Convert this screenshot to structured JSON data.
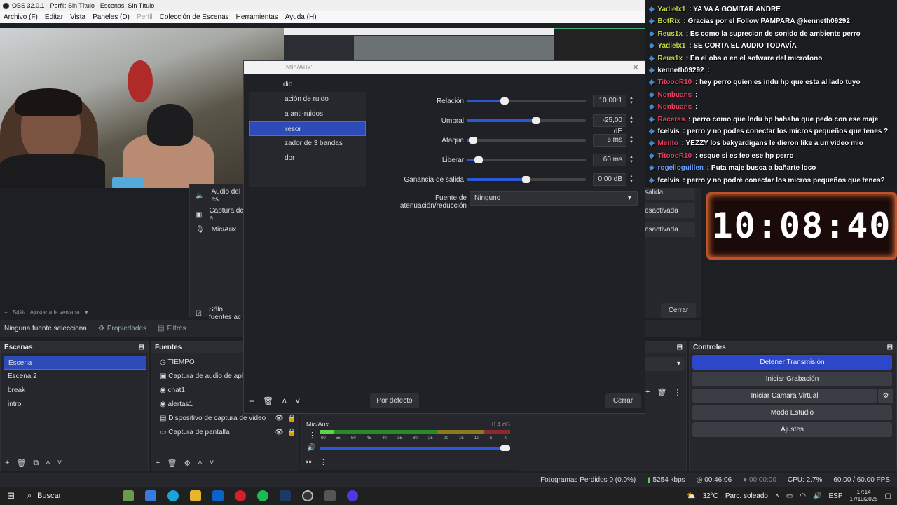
{
  "titlebar": {
    "title": "OBS 32.0.1 - Perfil: Sin Título - Escenas: Sin Título"
  },
  "menu": {
    "items": [
      "Archivo (F)",
      "Editar",
      "Vista",
      "Paneles (D)",
      "Perfil",
      "Colección de Escenas",
      "Herramientas",
      "Ayuda (H)"
    ]
  },
  "sources_panel_partial": {
    "items": [
      "Audio del es",
      "Captura de a",
      "Mic/Aux"
    ],
    "only_sources": "Sólo fuentes ac"
  },
  "zoom": {
    "level": "54%",
    "fit_label": "Ajustar a la ventana"
  },
  "propbar": {
    "no_source": "Ninguna fuente selecciona",
    "properties": "Propiedades",
    "filters": "Filtros"
  },
  "scenes": {
    "title": "Escenas",
    "items": [
      "Escena",
      "Escena 2",
      "break",
      "intro"
    ]
  },
  "sources": {
    "title": "Fuentes",
    "items": [
      "TIEMPO",
      "Captura de audio de aplicac",
      "chat1",
      "alertas1",
      "Dispositivo de captura de video",
      "Captura de pantalla"
    ]
  },
  "dialog": {
    "title": "'Mic/Aux'",
    "section": "dio",
    "filters": [
      "ación de ruido",
      "a anti-ruidos",
      "resor",
      "zador de 3 bandas",
      "dor"
    ],
    "params": [
      {
        "label": "Relación",
        "value": "10,00:1",
        "level": 0.32
      },
      {
        "label": "Umbral",
        "value": "-25,00 dE",
        "level": 0.58
      },
      {
        "label": "Ataque",
        "value": "6 ms",
        "level": 0.05
      },
      {
        "label": "Liberar",
        "value": "60 ms",
        "level": 0.1
      },
      {
        "label": "Ganancia de salida",
        "value": "0,00 dB",
        "level": 0.5
      }
    ],
    "duck_label": "Fuente de atenuación/reducción",
    "duck_value": "Ninguno",
    "default_button": "Por defecto",
    "close_button": "Cerrar"
  },
  "side_partial": {
    "items": [
      "salida",
      "esactivada",
      "esactivada"
    ],
    "close": "Cerrar"
  },
  "chat": {
    "lines": [
      {
        "user": "Yadielx1",
        "msg": ": YA VA A GOMITAR ANDRE",
        "color": "#c8d84a"
      },
      {
        "user": "BotRix",
        "msg": ": Gracias por el Follow PAMPARA @kenneth09292",
        "color": "#c8d84a"
      },
      {
        "user": "Reus1x",
        "msg": ": Es como la suprecion de sonido de ambiente perro",
        "color": "#c8d84a"
      },
      {
        "user": "Yadielx1",
        "msg": ": SE CORTA EL AUDIO TODAVÍA",
        "color": "#c8d84a"
      },
      {
        "user": "Reus1x",
        "msg": ": En el obs o en el sofware del microfono",
        "color": "#c8d84a"
      },
      {
        "user": "kenneth09292",
        "msg": ":",
        "color": "#fff"
      },
      {
        "user": "TitoooR10",
        "msg": ": hey perro quien es indu hp que esta al lado tuyo",
        "color": "#e74060"
      },
      {
        "user": "Nonbuans",
        "msg": ":",
        "color": "#e74060"
      },
      {
        "user": "Nonbuans",
        "msg": ":",
        "color": "#e74060"
      },
      {
        "user": "Raceras",
        "msg": ": perro como que Indu hp hahaha que pedo con ese maje",
        "color": "#e74060"
      },
      {
        "user": "fcelvis",
        "msg": ": perro y no podes conectar los micros pequeños que tenes ?",
        "color": "#fff"
      },
      {
        "user": "Mento",
        "msg": ": YEZZY los bakyardigans le dieron like a un video mio",
        "color": "#e74060"
      },
      {
        "user": "TitoooR10",
        "msg": ": esque si es feo ese hp perro",
        "color": "#e74060"
      },
      {
        "user": "rogelioguillen",
        "msg": ": Puta maje busca a bañarte loco",
        "color": "#6aa0ff"
      },
      {
        "user": "fcelvis",
        "msg": ": perro y no podré conectar los micros pequeños que tenes?",
        "color": "#fff"
      }
    ]
  },
  "timer": {
    "value": "10:08:40"
  },
  "mixer": {
    "name": "Mic/Aux",
    "level": "0.4 dB",
    "ticks": [
      "-60",
      "-55",
      "-50",
      "-45",
      "-40",
      "-35",
      "-30",
      "-25",
      "-20",
      "-15",
      "-10",
      "-5",
      "0"
    ]
  },
  "controls": {
    "title": "Controles",
    "buttons": [
      "Detener Transmisión",
      "Iniciar Grabación",
      "Iniciar Cámara Virtual",
      "Modo Estudio",
      "Ajustes"
    ]
  },
  "status": {
    "dropped": "Fotogramas Perdidos 0 (0.0%)",
    "bitrate": "5254 kbps",
    "stream_time": "00:46:06",
    "rec_time": "00:00:00",
    "cpu": "CPU: 2.7%",
    "fps": "60.00 / 60.00 FPS"
  },
  "taskbar": {
    "search": "Buscar",
    "weather": "32°C",
    "weather_desc": "Parc. soleado",
    "lang": "ESP",
    "time": "17:14",
    "date": "17/10/2025"
  },
  "colors": {
    "accent": "#2c4bb9",
    "primary_button": "#2c47c9",
    "slider_fill": "#2c57d6"
  }
}
